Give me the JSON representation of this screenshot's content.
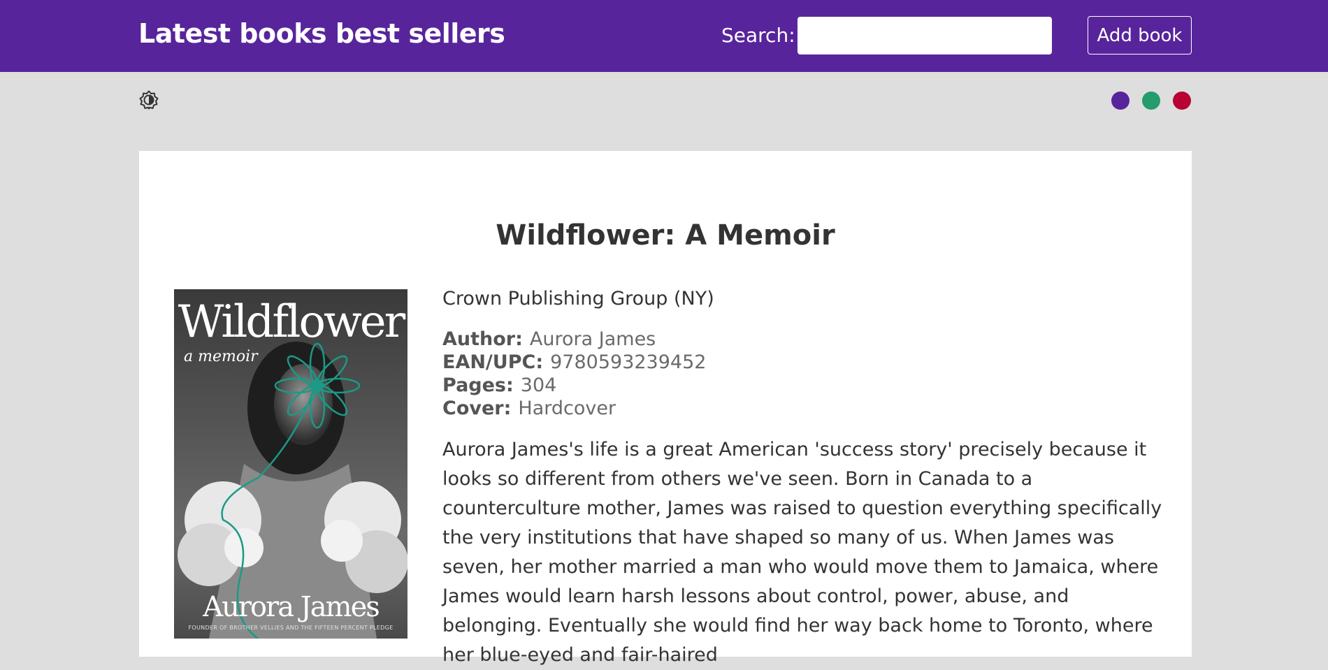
{
  "header": {
    "title": "Latest books best sellers",
    "search_label": "Search:",
    "search_placeholder": "",
    "search_value": "",
    "add_button_label": "Add book"
  },
  "toolbar": {
    "theme_toggle_icon": "contrast-icon",
    "swatches": [
      {
        "name": "purple",
        "color": "#58249c"
      },
      {
        "name": "green",
        "color": "#249c6b"
      },
      {
        "name": "red",
        "color": "#b70233"
      }
    ]
  },
  "book": {
    "title": "Wildflower: A Memoir",
    "publisher": "Crown Publishing Group (NY)",
    "author_label": "Author:",
    "author": "Aurora James",
    "ean_label": "EAN/UPC:",
    "ean": "9780593239452",
    "pages_label": "Pages:",
    "pages": "304",
    "cover_label": "Cover:",
    "cover": "Hardcover",
    "description": "Aurora James's life is a great American 'success story' precisely because it looks so different from others we've seen. Born in Canada to a counterculture mother, James was raised to question everything specifically the very institutions that have shaped so many of us. When James was seven, her mother married a man who would move them to Jamaica, where James would learn harsh lessons about control, power, abuse, and belonging. Eventually she would find her way back home to Toronto, where her blue-eyed and fair-haired",
    "cover_image": {
      "title_text": "Wildflower",
      "subtitle_text": "a memoir",
      "author_text": "Aurora James",
      "tagline_text": "FOUNDER OF BROTHER VELLIES AND THE FIFTEEN PERCENT PLEDGE",
      "accent_color": "#1b9a86"
    }
  }
}
